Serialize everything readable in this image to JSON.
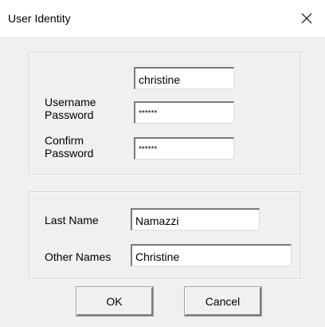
{
  "window": {
    "title": "User Identity",
    "close_icon": "close-icon"
  },
  "account": {
    "username_label": "Username",
    "username_value": "christine",
    "password_label": "Password",
    "password_value": "******",
    "confirm_label_line1": "Confirm",
    "confirm_label_line2": "Password",
    "confirm_value": "******"
  },
  "names": {
    "last_name_label": "Last Name",
    "last_name_value": "Namazzi",
    "other_names_label": "Other Names",
    "other_names_value": "Christine"
  },
  "buttons": {
    "ok_label": "OK",
    "cancel_label": "Cancel"
  }
}
